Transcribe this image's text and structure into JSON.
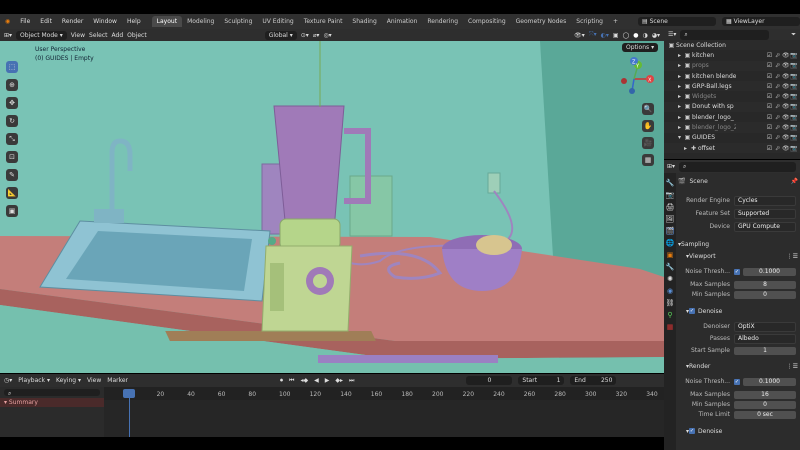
{
  "menu": {
    "items": [
      "File",
      "Edit",
      "Render",
      "Window",
      "Help"
    ],
    "workspaces": [
      "Layout",
      "Modeling",
      "Sculpting",
      "UV Editing",
      "Texture Paint",
      "Shading",
      "Animation",
      "Rendering",
      "Compositing",
      "Geometry Nodes",
      "Scripting"
    ],
    "active_workspace": "Layout",
    "scene": "Scene",
    "view_layer": "ViewLayer"
  },
  "viewport": {
    "mode": "Object Mode",
    "menus": [
      "View",
      "Select",
      "Add",
      "Object"
    ],
    "transform": "Global",
    "options": "Options",
    "overlay_title": "User Perspective",
    "overlay_subtitle": "(0) GUIDES | Empty",
    "gizmo": {
      "x": "X",
      "y": "Y",
      "z": "Z"
    }
  },
  "outliner": {
    "root": "Scene Collection",
    "items": [
      {
        "name": "kitchen",
        "dim": false
      },
      {
        "name": "props",
        "dim": true
      },
      {
        "name": "kitchen blende",
        "dim": false
      },
      {
        "name": "GRP-Ball.legs",
        "dim": false
      },
      {
        "name": "Widgets",
        "dim": true
      },
      {
        "name": "Donut with sp",
        "dim": false
      },
      {
        "name": "blender_logo_",
        "dim": false
      },
      {
        "name": "blender_logo_2",
        "dim": true
      },
      {
        "name": "GUIDES",
        "dim": false
      },
      {
        "name": "offset",
        "dim": false
      }
    ]
  },
  "properties": {
    "scene_name": "Scene",
    "render_engine_label": "Render Engine",
    "render_engine": "Cycles",
    "feature_set_label": "Feature Set",
    "feature_set": "Supported",
    "device_label": "Device",
    "device": "GPU Compute",
    "sampling": "Sampling",
    "viewport_section": "Viewport",
    "noise_threshold_label": "Noise Thresh...",
    "viewport_noise_threshold": "0.1000",
    "max_samples_label": "Max Samples",
    "viewport_max_samples": "8",
    "min_samples_label": "Min Samples",
    "viewport_min_samples": "0",
    "denoise_label": "Denoise",
    "denoiser_label": "Denoiser",
    "denoiser": "OptiX",
    "passes_label": "Passes",
    "passes": "Albedo",
    "start_sample_label": "Start Sample",
    "start_sample": "1",
    "render_section": "Render",
    "render_noise_threshold": "0.1000",
    "render_max_samples": "16",
    "render_min_samples": "0",
    "time_limit_label": "Time Limit",
    "time_limit": "0 sec",
    "render_denoise_label": "Denoise"
  },
  "timeline": {
    "menus": [
      "Playback",
      "Keying",
      "View",
      "Marker"
    ],
    "current_frame": "0",
    "start_label": "Start",
    "start": "1",
    "end_label": "End",
    "end": "250",
    "summary": "Summary",
    "ticks": [
      "0",
      "20",
      "40",
      "60",
      "80",
      "100",
      "120",
      "140",
      "160",
      "180",
      "200",
      "220",
      "240",
      "260",
      "280",
      "300",
      "320",
      "340"
    ]
  }
}
